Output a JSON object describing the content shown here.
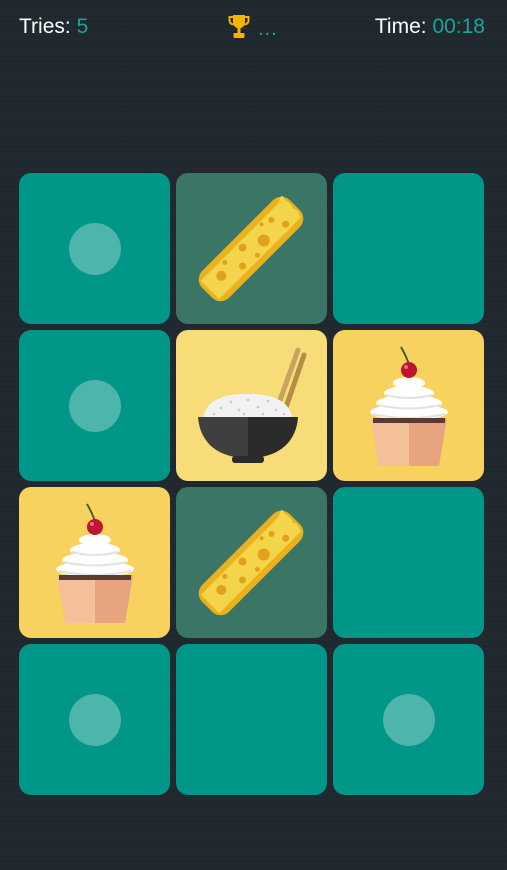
{
  "header": {
    "tries_label": "Tries:",
    "tries_value": "5",
    "best_score": "...",
    "time_label": "Time:",
    "time_value": "00:18"
  },
  "colors": {
    "background": "#1f282e",
    "accent": "#19a597",
    "card_back": "#009688",
    "card_matched": "#3b7565",
    "card_face": "#f7d25e",
    "trophy": "#f4b400"
  },
  "board": {
    "rows": 4,
    "columns": 3,
    "cards": [
      {
        "state": "hidden",
        "marker": true,
        "icon": null
      },
      {
        "state": "matched",
        "marker": false,
        "icon": "cheese-icon"
      },
      {
        "state": "hidden",
        "marker": false,
        "icon": null
      },
      {
        "state": "hidden",
        "marker": true,
        "icon": null
      },
      {
        "state": "revealed",
        "marker": false,
        "icon": "rice-bowl-icon"
      },
      {
        "state": "revealed",
        "marker": false,
        "icon": "cupcake-icon"
      },
      {
        "state": "revealed",
        "marker": false,
        "icon": "cupcake-icon"
      },
      {
        "state": "matched",
        "marker": false,
        "icon": "cheese-icon"
      },
      {
        "state": "hidden",
        "marker": false,
        "icon": null
      },
      {
        "state": "hidden",
        "marker": true,
        "icon": null
      },
      {
        "state": "hidden",
        "marker": false,
        "icon": null
      },
      {
        "state": "hidden",
        "marker": true,
        "icon": null
      }
    ]
  }
}
